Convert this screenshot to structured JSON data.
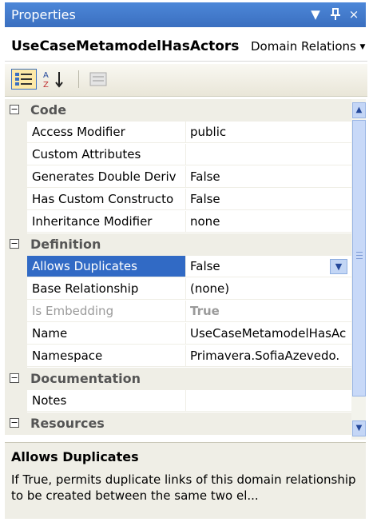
{
  "window": {
    "title": "Properties",
    "buttons": {
      "dropdown": "▼",
      "pin": "ᑫ",
      "close": "×"
    }
  },
  "object_selector": {
    "name": "UseCaseMetamodelHasActors",
    "type": "Domain Relations",
    "arrow": "▼"
  },
  "toolbar": {
    "categorized": "categorized-icon",
    "alphabetical": "alphabetical-sort-icon",
    "property_pages": "property-pages-icon"
  },
  "categories": {
    "code": "Code",
    "definition": "Definition",
    "documentation": "Documentation",
    "resources": "Resources"
  },
  "code_props": [
    {
      "name": "Access Modifier",
      "value": "public"
    },
    {
      "name": "Custom Attributes",
      "value": ""
    },
    {
      "name": "Generates Double Deriv",
      "value": "False"
    },
    {
      "name": "Has Custom Constructo",
      "value": "False"
    },
    {
      "name": "Inheritance Modifier",
      "value": "none"
    }
  ],
  "definition_props": [
    {
      "name": "Allows Duplicates",
      "value": "False"
    },
    {
      "name": "Base Relationship",
      "value": "(none)"
    },
    {
      "name": "Is Embedding",
      "value": "True"
    },
    {
      "name": "Name",
      "value": "UseCaseMetamodelHasAc"
    },
    {
      "name": "Namespace",
      "value": "Primavera.SofiaAzevedo."
    }
  ],
  "documentation_props": [
    {
      "name": "Notes",
      "value": ""
    }
  ],
  "description": {
    "title": "Allows Duplicates",
    "text": "If True, permits duplicate links of this domain relationship to be created between the same two el..."
  },
  "colors": {
    "title_bar": "#3a6fc0",
    "selection": "#316ac5",
    "category_bg": "#efeee6"
  }
}
